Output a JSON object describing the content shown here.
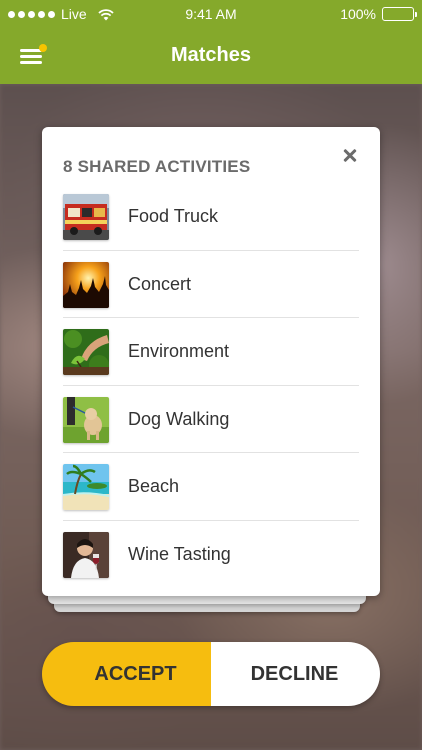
{
  "status_bar": {
    "carrier": "Live",
    "time": "9:41 AM",
    "battery": "100%",
    "battery_level": 1.0
  },
  "nav": {
    "title": "Matches",
    "menu_icon": "hamburger-menu-icon",
    "notification_color": "#f6c400"
  },
  "modal": {
    "title": "8 SHARED ACTIVITIES",
    "close_icon": "close-icon",
    "activities": [
      {
        "label": "Food Truck",
        "image": "food-truck-photo"
      },
      {
        "label": "Concert",
        "image": "concert-photo"
      },
      {
        "label": "Environment",
        "image": "environment-photo"
      },
      {
        "label": "Dog Walking",
        "image": "dog-walking-photo"
      },
      {
        "label": "Beach",
        "image": "beach-photo"
      },
      {
        "label": "Wine Tasting",
        "image": "wine-tasting-photo"
      }
    ]
  },
  "actions": {
    "accept_label": "ACCEPT",
    "decline_label": "DECLINE"
  },
  "colors": {
    "brand_green": "#85a92b",
    "accept_yellow": "#f6bd0f"
  }
}
